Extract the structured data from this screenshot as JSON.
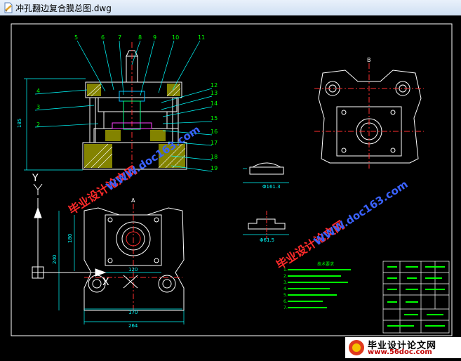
{
  "window": {
    "title": "冲孔翻边复合膜总图.dwg"
  },
  "drawing": {
    "part_numbers_top": [
      "5",
      "6",
      "7",
      "8",
      "9",
      "10",
      "11"
    ],
    "part_numbers_right": [
      "12",
      "13",
      "14",
      "15",
      "16",
      "17",
      "18",
      "19"
    ],
    "part_numbers_left": [
      "4",
      "3",
      "2"
    ],
    "side_dim": "185",
    "plan_dims": {
      "width_inner": "120",
      "width_mid": "170",
      "width_outer": "264",
      "height_outer": "240",
      "height_inner": "180"
    },
    "plan_mark_top": "A",
    "top_right_mark": "B",
    "ucs_y": "Y",
    "ucs_x": "X",
    "part_view_dims": [
      "Φ161.3",
      "Φ61.5"
    ],
    "notes_title": "技术要求",
    "notes_lines": [
      "1.",
      "2.",
      "3.",
      "4.",
      "5.",
      "6.",
      "7."
    ]
  },
  "watermarks": {
    "cn_text": "毕业设计论文网",
    "url_text": "WWW.doc163.com"
  },
  "logo": {
    "line1": "毕业设计论文网",
    "line2": "www.56doc.com"
  },
  "colors": {
    "frame": "#ffffff",
    "part_lines": "#ffffff",
    "dimension": "#00ffff",
    "centerline": "#ff3030",
    "hatch": "#c8c800",
    "notes": "#00ff00",
    "watermark_red": "#ff2a2a",
    "watermark_blue": "#3a62ff"
  }
}
